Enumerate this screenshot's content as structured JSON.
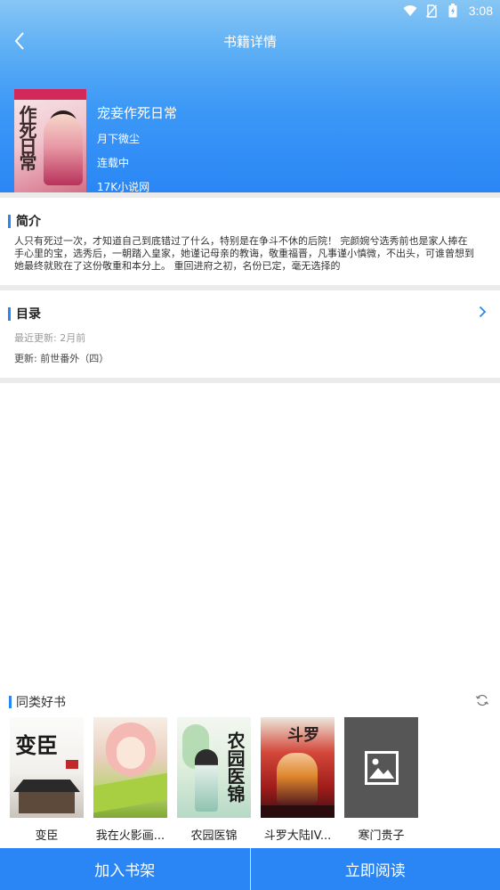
{
  "status_bar": {
    "time": "3:08",
    "icons": [
      "wifi-icon",
      "no-sim-icon",
      "battery-charging-icon"
    ]
  },
  "header": {
    "title": "书籍详情",
    "back_icon": "chevron-left-icon"
  },
  "book": {
    "title": "宠妾作死日常",
    "author": "月下微尘",
    "status": "连载中",
    "source": "17K小说网",
    "cover_text": "作死日常"
  },
  "intro": {
    "label": "简介",
    "text": "人只有死过一次，才知道自己到底错过了什么，特别是在争斗不休的后院！ 完颜婉兮选秀前也是家人捧在手心里的宝，选秀后，一朝踏入皇家，她谨记母亲的教诲，敬重福晋，凡事谨小慎微，不出头，可谁曾想到她最终就败在了这份敬重和本分上。 重回进府之初，名份已定，毫无选择的"
  },
  "toc": {
    "label": "目录",
    "last_update": "最近更新: 2月前",
    "latest_chapter": "更新: 前世番外（四）"
  },
  "similar": {
    "label": "同类好书",
    "books": [
      {
        "name": "变臣",
        "cover_text": "变臣"
      },
      {
        "name": "我在火影画...",
        "cover_text": ""
      },
      {
        "name": "农园医锦",
        "cover_text": "农园医锦"
      },
      {
        "name": "斗罗大陆IV...",
        "cover_text": "斗罗"
      },
      {
        "name": "寒门贵子",
        "cover_text": ""
      }
    ]
  },
  "actions": {
    "add_shelf": "加入书架",
    "read_now": "立即阅读"
  },
  "colors": {
    "accent": "#2a86f5",
    "divider": "#ebebeb"
  }
}
